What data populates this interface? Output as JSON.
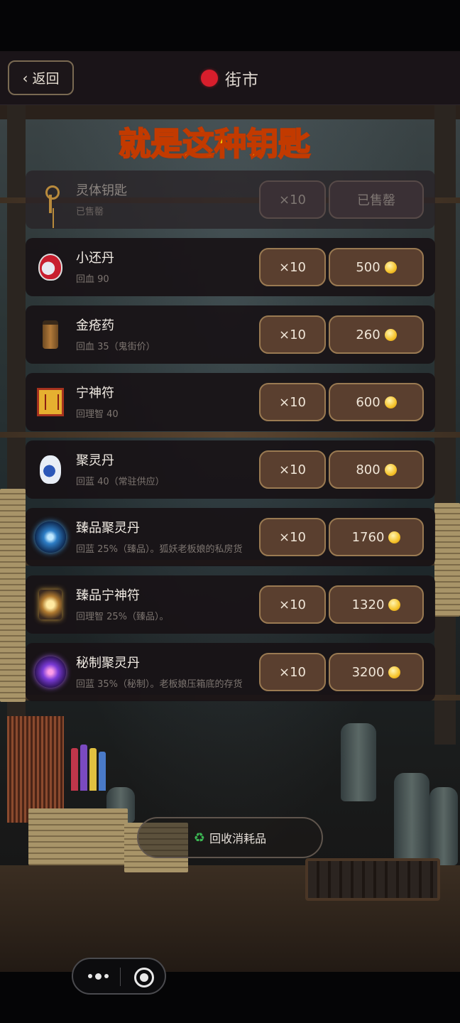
{
  "header": {
    "back_label": "返回",
    "title": "街市"
  },
  "caption": "就是这种钥匙",
  "items": [
    {
      "name": "灵体钥匙",
      "desc": "已售罄",
      "qty": "×10",
      "price": "已售罄",
      "icon": "key-icon",
      "sold_out": true
    },
    {
      "name": "小还丹",
      "desc": "回血 90",
      "qty": "×10",
      "price": "500",
      "icon": "potion-icon"
    },
    {
      "name": "金疮药",
      "desc": "回血 35（鬼街价）",
      "qty": "×10",
      "price": "260",
      "icon": "medicine-jar-icon"
    },
    {
      "name": "宁神符",
      "desc": "回理智 40",
      "qty": "×10",
      "price": "600",
      "icon": "talisman-icon"
    },
    {
      "name": "聚灵丹",
      "desc": "回蓝 40（常驻供应）",
      "qty": "×10",
      "price": "800",
      "icon": "porcelain-vase-icon"
    },
    {
      "name": "臻品聚灵丹",
      "desc": "回蓝 25%（臻品）。狐妖老板娘的私房货",
      "qty": "×10",
      "price": "1760",
      "icon": "spirit-orb-icon"
    },
    {
      "name": "臻品宁神符",
      "desc": "回理智 25%（臻品）。",
      "qty": "×10",
      "price": "1320",
      "icon": "glowing-talisman-icon"
    },
    {
      "name": "秘制聚灵丹",
      "desc": "回蓝 35%（秘制）。老板娘压箱底的存货",
      "qty": "×10",
      "price": "3200",
      "icon": "galaxy-orb-icon"
    }
  ],
  "recycle_label": "回收消耗品",
  "colors": {
    "accent": "#9a7a52",
    "button_bg": "#5a3f2f",
    "title_dot": "#d81e2c",
    "caption": "#ffe600",
    "coin": "#f5c22a"
  }
}
